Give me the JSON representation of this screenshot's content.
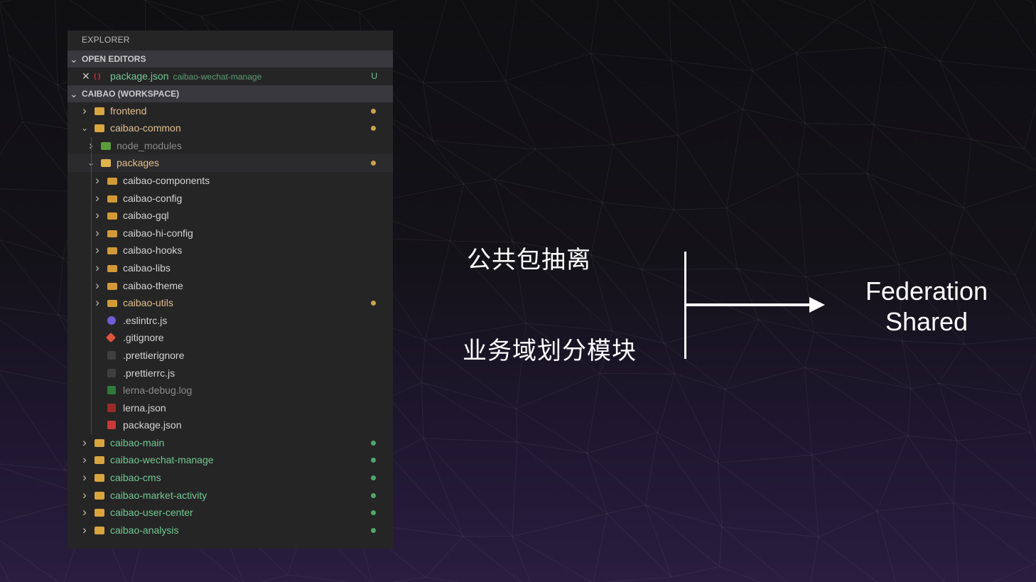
{
  "explorer": {
    "title": "EXPLORER",
    "open_editors": {
      "label": "OPEN EDITORS",
      "items": [
        {
          "name": "package.json",
          "description": "caibao-wechat-manage",
          "badge": "U",
          "file_tag": "{ }"
        }
      ]
    },
    "workspace": {
      "label": "CAIBAO (WORKSPACE)",
      "tree": [
        {
          "label": "frontend",
          "depth": 0,
          "kind": "folder",
          "expanded": false,
          "icon": "folder-open-yellow",
          "color": "#e2c08d",
          "dot": "#c9a34e"
        },
        {
          "label": "caibao-common",
          "depth": 0,
          "kind": "folder",
          "expanded": true,
          "icon": "folder-open-yellow",
          "color": "#e2c08d",
          "dot": "#c9a34e"
        },
        {
          "label": "node_modules",
          "depth": 1,
          "kind": "folder",
          "expanded": false,
          "icon": "folder-node-green",
          "color": "#8b8b8b"
        },
        {
          "label": "packages",
          "depth": 1,
          "kind": "folder",
          "expanded": true,
          "icon": "folder-packages-yellow",
          "color": "#e2c08d",
          "dot": "#c9a34e",
          "highlight": true
        },
        {
          "label": "caibao-components",
          "depth": 2,
          "kind": "folder",
          "expanded": false,
          "icon": "folder-yellow",
          "color": "#d4d4d4"
        },
        {
          "label": "caibao-config",
          "depth": 2,
          "kind": "folder",
          "expanded": false,
          "icon": "folder-yellow",
          "color": "#d4d4d4"
        },
        {
          "label": "caibao-gql",
          "depth": 2,
          "kind": "folder",
          "expanded": false,
          "icon": "folder-yellow",
          "color": "#d4d4d4"
        },
        {
          "label": "caibao-hi-config",
          "depth": 2,
          "kind": "folder",
          "expanded": false,
          "icon": "folder-yellow",
          "color": "#d4d4d4"
        },
        {
          "label": "caibao-hooks",
          "depth": 2,
          "kind": "folder",
          "expanded": false,
          "icon": "folder-yellow",
          "color": "#d4d4d4"
        },
        {
          "label": "caibao-libs",
          "depth": 2,
          "kind": "folder",
          "expanded": false,
          "icon": "folder-yellow",
          "color": "#d4d4d4"
        },
        {
          "label": "caibao-theme",
          "depth": 2,
          "kind": "folder",
          "expanded": false,
          "icon": "folder-yellow",
          "color": "#d4d4d4"
        },
        {
          "label": "caibao-utils",
          "depth": 2,
          "kind": "folder",
          "expanded": false,
          "icon": "folder-yellow",
          "color": "#e2c08d",
          "dot": "#c9a34e"
        },
        {
          "label": ".eslintrc.js",
          "depth": 2,
          "kind": "file",
          "icon": "eslint-icon",
          "color": "#d4d4d4"
        },
        {
          "label": ".gitignore",
          "depth": 2,
          "kind": "file",
          "icon": "git-icon",
          "color": "#d4d4d4"
        },
        {
          "label": ".prettierignore",
          "depth": 2,
          "kind": "file",
          "icon": "prettier-icon",
          "color": "#d4d4d4"
        },
        {
          "label": ".prettierrc.js",
          "depth": 2,
          "kind": "file",
          "icon": "prettier-icon",
          "color": "#d4d4d4"
        },
        {
          "label": "lerna-debug.log",
          "depth": 2,
          "kind": "file",
          "icon": "log-file-icon",
          "color": "#8b8b8b"
        },
        {
          "label": "lerna.json",
          "depth": 2,
          "kind": "file",
          "icon": "lerna-icon",
          "color": "#d4d4d4"
        },
        {
          "label": "package.json",
          "depth": 2,
          "kind": "file",
          "icon": "json-file-icon",
          "color": "#d4d4d4"
        },
        {
          "label": "caibao-main",
          "depth": 0,
          "kind": "folder",
          "expanded": false,
          "icon": "folder-open-yellow",
          "color": "#73c991",
          "dot": "#4fa66a"
        },
        {
          "label": "caibao-wechat-manage",
          "depth": 0,
          "kind": "folder",
          "expanded": false,
          "icon": "folder-open-yellow",
          "color": "#73c991",
          "dot": "#4fa66a"
        },
        {
          "label": "caibao-cms",
          "depth": 0,
          "kind": "folder",
          "expanded": false,
          "icon": "folder-open-yellow",
          "color": "#73c991",
          "dot": "#4fa66a"
        },
        {
          "label": "caibao-market-activity",
          "depth": 0,
          "kind": "folder",
          "expanded": false,
          "icon": "folder-open-yellow",
          "color": "#73c991",
          "dot": "#4fa66a"
        },
        {
          "label": "caibao-user-center",
          "depth": 0,
          "kind": "folder",
          "expanded": false,
          "icon": "folder-open-yellow",
          "color": "#73c991",
          "dot": "#4fa66a"
        },
        {
          "label": "caibao-analysis",
          "depth": 0,
          "kind": "folder",
          "expanded": false,
          "icon": "folder-open-yellow",
          "color": "#73c991",
          "dot": "#4fa66a"
        }
      ]
    }
  },
  "diagram": {
    "left_top": "公共包抽离",
    "left_bottom": "业务域划分模块",
    "right_line1": "Federation",
    "right_line2": "Shared"
  },
  "colors": {
    "panel": "#252526",
    "section": "#38383d",
    "modified": "#e2c08d",
    "untracked": "#73c991",
    "arrow": "#ffffff"
  }
}
